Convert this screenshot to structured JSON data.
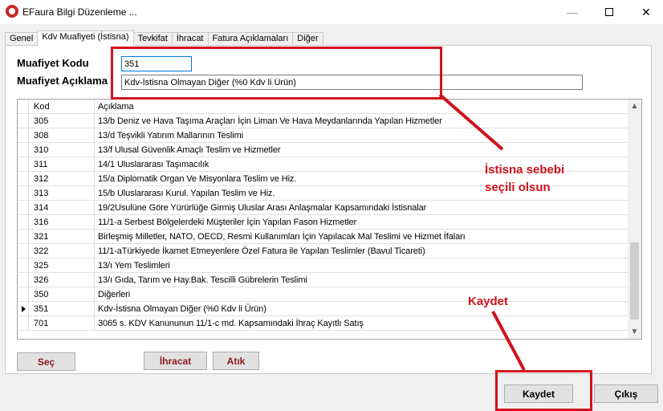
{
  "window": {
    "title": "EFaura Bilgi Düzenleme ...",
    "controls": {
      "minimize": "—",
      "close": "✕"
    }
  },
  "tabs": [
    {
      "label": "Genel",
      "active": false
    },
    {
      "label": "Kdv Muafiyeti (İstisna)",
      "active": true
    },
    {
      "label": "Tevkifat",
      "active": false
    },
    {
      "label": "İhracat",
      "active": false
    },
    {
      "label": "Fatura Açıklamaları",
      "active": false
    },
    {
      "label": "Diğer",
      "active": false
    }
  ],
  "form": {
    "kod_label": "Muafiyet Kodu",
    "kod_value": "351",
    "aciklama_label": "Muafiyet Açıklama",
    "aciklama_value": "Kdv-İstisna Olmayan Diğer (%0 Kdv li Ürün)"
  },
  "grid": {
    "columns": [
      "Kod",
      "Açıklama"
    ],
    "selected_code": "351",
    "rows": [
      {
        "kod": "305",
        "aciklama": "13/b Deniz ve Hava Taşıma Araçları İçin Liman Ve Hava Meydanlarında Yapılan Hizmetler"
      },
      {
        "kod": "308",
        "aciklama": "13/d Teşvikli Yatırım Mallarının Teslimi"
      },
      {
        "kod": "310",
        "aciklama": "13/f Ulusal Güvenlik Amaçlı Teslim ve Hizmetler"
      },
      {
        "kod": "311",
        "aciklama": "14/1 Uluslararası Taşımacılık"
      },
      {
        "kod": "312",
        "aciklama": "15/a Diplomatik Organ Ve Misyonlara Teslim ve Hiz."
      },
      {
        "kod": "313",
        "aciklama": "15/b Uluslararası Kurul. Yapılan Teslim ve Hiz."
      },
      {
        "kod": "314",
        "aciklama": "19/2Usulüne Göre Yürürlüğe Girmiş Uluslar Arası Anlaşmalar Kapsamındaki İstisnalar"
      },
      {
        "kod": "316",
        "aciklama": "11/1-a Serbest Bölgelerdeki Müşteriler İçin Yapılan Fason Hizmetler"
      },
      {
        "kod": "321",
        "aciklama": "Birleşmiş Milletler, NATO, OECD, Resmi Kullanımları İçin Yapılacak Mal Teslimi ve Hizmet İfaları"
      },
      {
        "kod": "322",
        "aciklama": "11/1-aTürkiyede İkamet Etmeyenlere Özel Fatura ile Yapılan Teslimler (Bavul Ticareti)"
      },
      {
        "kod": "325",
        "aciklama": "13/ı Yem Teslimleri"
      },
      {
        "kod": "326",
        "aciklama": "13/ı Gıda, Tarım ve Hay.Bak. Tescilli Gübrelerin Teslimi"
      },
      {
        "kod": "350",
        "aciklama": "Diğerleri"
      },
      {
        "kod": "351",
        "aciklama": "Kdv-İstisna Olmayan Diğer (%0 Kdv li Ürün)"
      },
      {
        "kod": "701",
        "aciklama": "3065 s. KDV Kanununun 11/1-c md. Kapsamındaki İhraç Kayıtlı Satış"
      }
    ]
  },
  "buttons": {
    "sec": "Seç",
    "ihracat": "İhracat",
    "atik": "Atık",
    "kaydet": "Kaydet",
    "cikis": "Çıkış"
  },
  "annotations": {
    "color": "#d0121c",
    "note_line1": "İstisna sebebi",
    "note_line2": "seçili olsun",
    "kaydet_note": "Kaydet"
  }
}
